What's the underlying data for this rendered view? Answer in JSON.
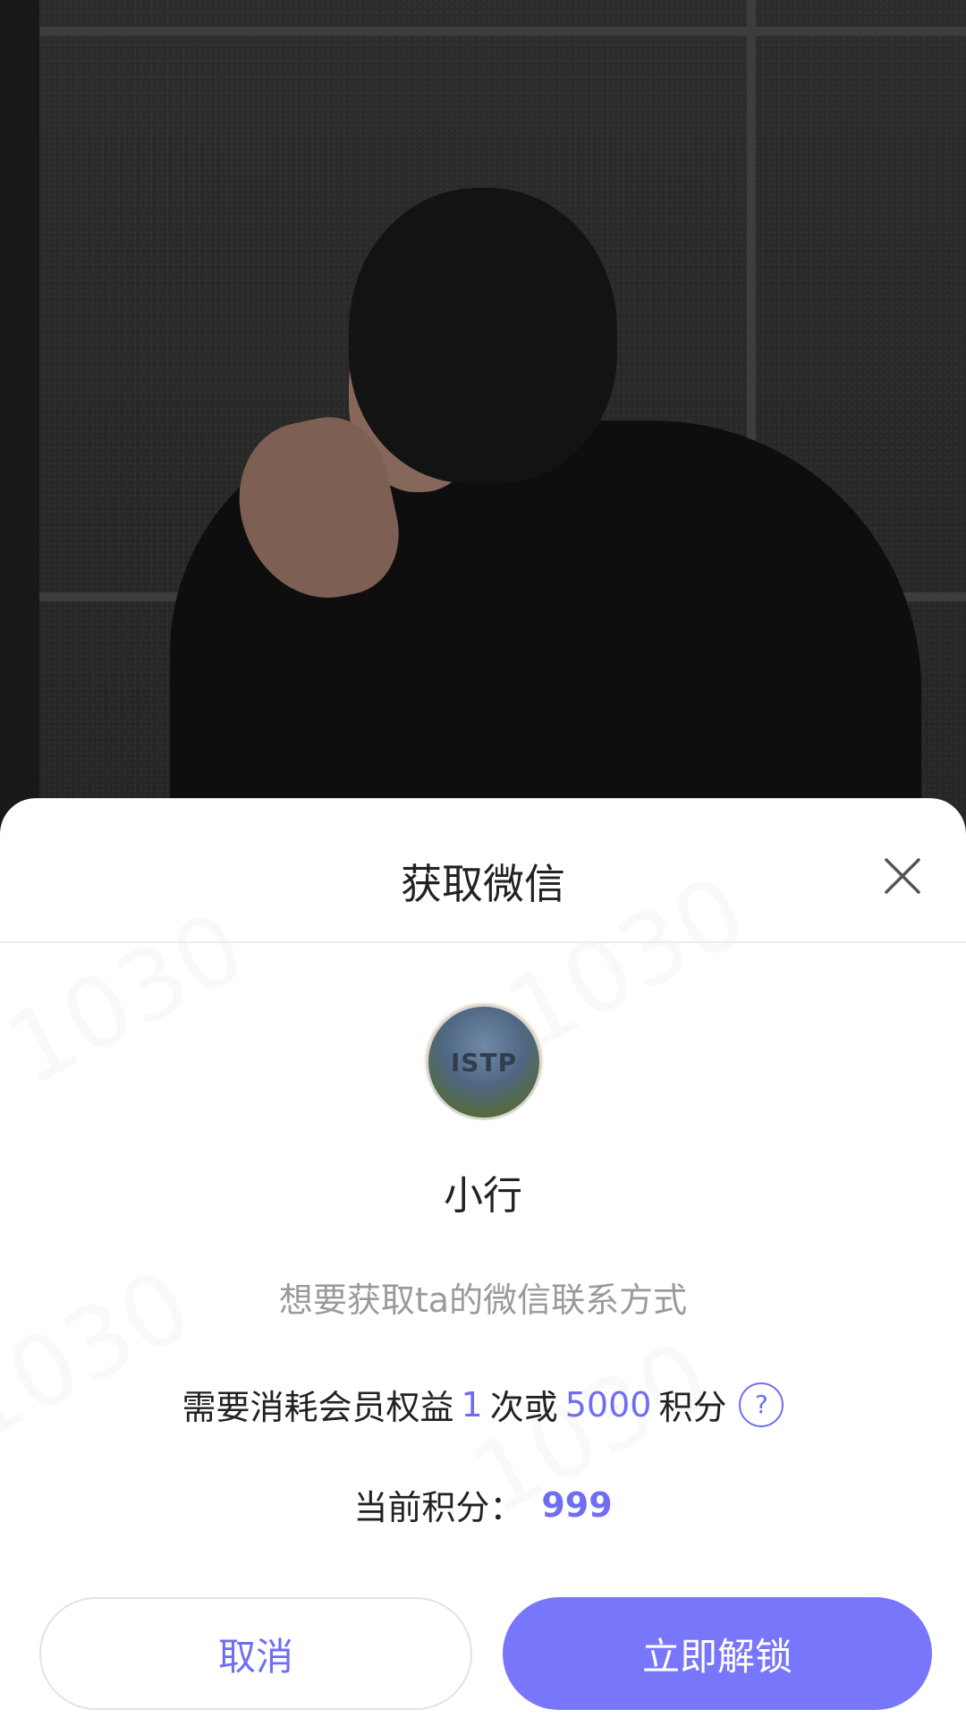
{
  "modal": {
    "title": "获取微信",
    "close_icon": "close-icon"
  },
  "profile": {
    "avatar_text": "ISTP",
    "name": "小行"
  },
  "message": {
    "description": "想要获取ta的微信联系方式",
    "cost_prefix": "需要消耗会员权益",
    "cost_times": "1",
    "cost_mid": "次或",
    "cost_points": "5000",
    "cost_suffix": "积分",
    "help_symbol": "?"
  },
  "points": {
    "label": "当前积分：",
    "value": "999"
  },
  "buttons": {
    "cancel": "取消",
    "unlock": "立即解锁"
  },
  "colors": {
    "accent": "#6f6ef2",
    "unlock_button": "#7876fb"
  }
}
